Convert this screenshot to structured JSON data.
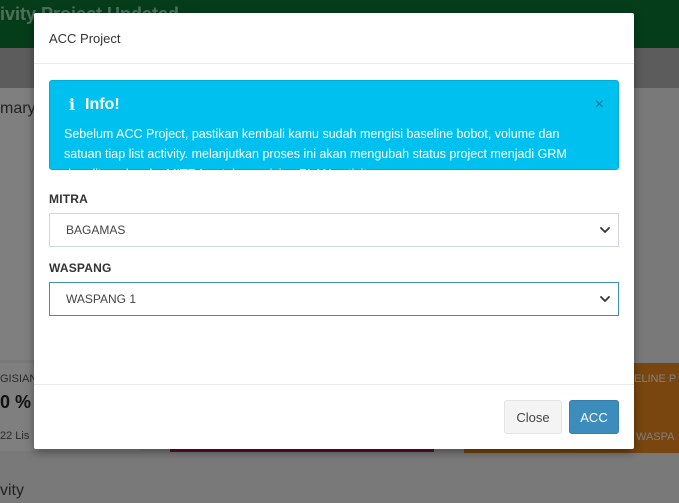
{
  "background": {
    "header_title": "ivity Project Updated",
    "summary_label": "mary",
    "stat_label": "GISIAN",
    "stat_value": "0 %",
    "stat_footer": "22 Lis",
    "orange_label": "ELINE P",
    "orange_footer": "WASPA",
    "activity_label": "vity"
  },
  "modal": {
    "title": "ACC Project",
    "alert": {
      "heading": "Info!",
      "icon": "info-icon",
      "close_symbol": "×",
      "message": "Sebelum ACC Project, pastikan kembali kamu sudah mengisi baseline bobot, volume dan satuan tiap list activity. melanjutkan proses ini akan mengubah status project menjadi GRM dan diteruskan ke MITRA untuk pengisian PLAN activity."
    },
    "fields": {
      "mitra_label": "MITRA",
      "mitra_value": "BAGAMAS",
      "waspang_label": "WASPANG",
      "waspang_value": "WASPANG 1"
    },
    "footer": {
      "close_label": "Close",
      "acc_label": "ACC"
    }
  },
  "colors": {
    "header_green": "#0b7a36",
    "alert_cyan": "#00c0ef",
    "primary_blue": "#3c8dbc",
    "orange": "#f08c1d",
    "magenta": "#c2185b"
  }
}
